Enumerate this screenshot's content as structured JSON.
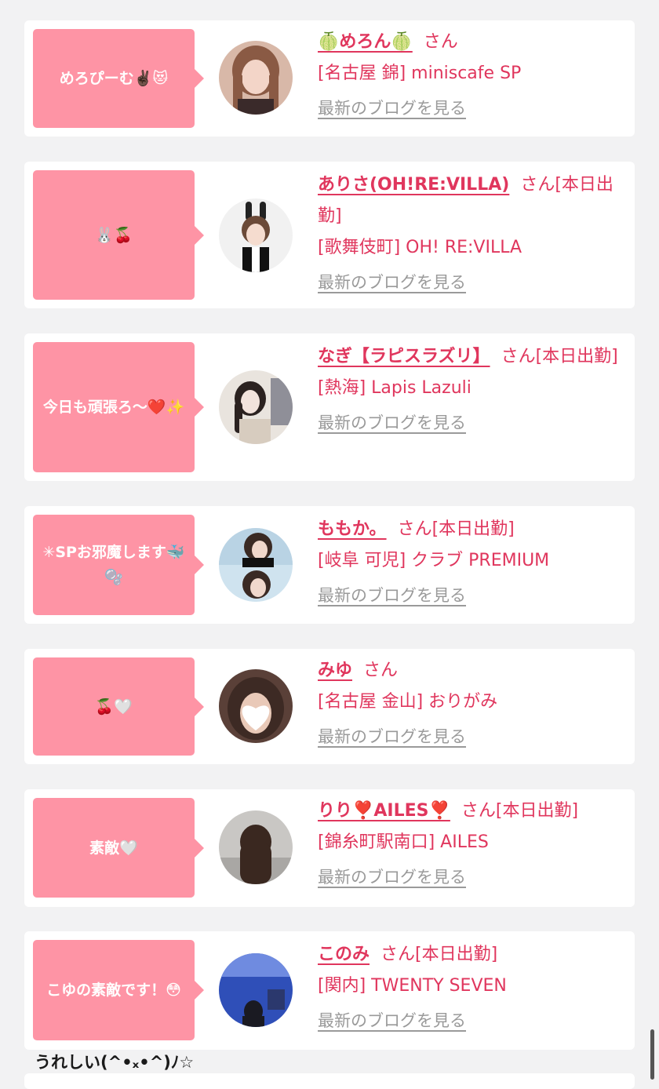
{
  "cards": [
    {
      "comment": "めろぴーむ✌🏿😻",
      "name": "🍈めろん🍈",
      "suffix": "さん",
      "shop": "[名古屋 錦] miniscafe SP",
      "blog": "最新のブログを見る"
    },
    {
      "comment": "🐰🍒",
      "name": "ありさ(OH!RE:VILLA)",
      "suffix": "さん[本日出勤]",
      "shop": "[歌舞伎町] OH! RE:VILLA",
      "blog": "最新のブログを見る"
    },
    {
      "comment": "今日も頑張ろ〜❤️✨",
      "name": "なぎ【ラピスラズリ】",
      "suffix": "さん[本日出勤]",
      "shop": "[熱海] Lapis Lazuli",
      "blog": "最新のブログを見る"
    },
    {
      "comment": "✳︎SPお邪魔します🐳🫧",
      "name": "ももか。",
      "suffix": "さん[本日出勤]",
      "shop": "[岐阜 可児] クラブ PREMIUM",
      "blog": "最新のブログを見る"
    },
    {
      "comment": "🍒🤍",
      "name": "みゆ",
      "suffix": "さん",
      "shop": "[名古屋 金山] おりがみ",
      "blog": "最新のブログを見る"
    },
    {
      "comment": "素敵🤍",
      "name": "りり❣️AILES❣️",
      "suffix": "さん[本日出勤]",
      "shop": "[錦糸町駅南口] AILES",
      "blog": "最新のブログを見る"
    },
    {
      "comment": "こゆの素敵です！😳",
      "name": "このみ",
      "suffix": "さん[本日出勤]",
      "shop": "[関内] TWENTY SEVEN",
      "blog": "最新のブログを見る"
    }
  ],
  "footer_note": "うれしい(^•ₓ•^)ﾉ☆",
  "colors": {
    "accent": "#e0365d",
    "bubble": "#fe94a5",
    "link_gray": "#9a9a9a",
    "background": "#f2f2f3"
  }
}
